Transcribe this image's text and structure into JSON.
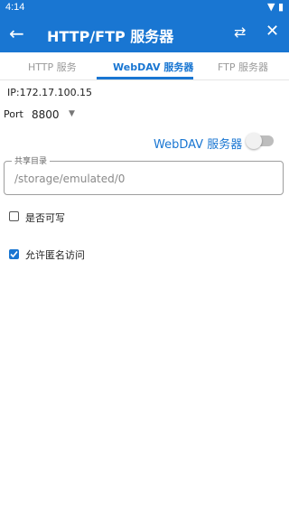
{
  "status_bar": {
    "time": "4:14",
    "icons": "wifi-icon battery-icon"
  },
  "app_bar": {
    "title": "HTTP/FTP 服务器"
  },
  "tabs": [
    {
      "label": "HTTP 服务",
      "active": false
    },
    {
      "label": "WebDAV 服务器",
      "active": true
    },
    {
      "label": "FTP 服务器",
      "active": false
    }
  ],
  "content": {
    "ip": "IP:172.17.100.15",
    "port_label": "Port",
    "port_value": "8800",
    "webdav_label": "WebDAV 服务器",
    "webdav_enabled": false,
    "share_dir": {
      "legend": "共享目录",
      "value": "/storage/emulated/0"
    },
    "writable": {
      "label": "是否可写",
      "checked": false
    },
    "anonymous": {
      "label": "允许匿名访问",
      "checked": true
    }
  },
  "colors": {
    "accent": "#1976d2"
  }
}
